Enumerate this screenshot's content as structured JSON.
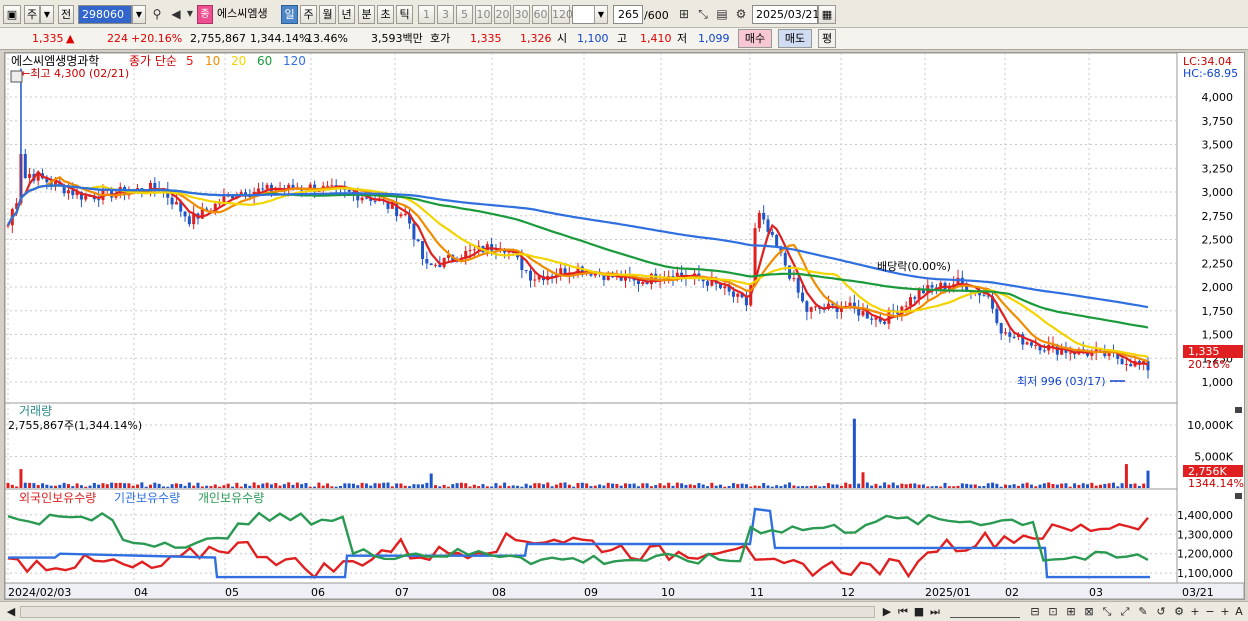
{
  "toolbar": {
    "market": "주",
    "period_prev": "전",
    "code": "298060",
    "badge": "종",
    "name": "에스씨엠생",
    "periods": [
      "일",
      "주",
      "월",
      "년",
      "분",
      "초",
      "틱"
    ],
    "ticks": [
      "1",
      "3",
      "5",
      "10",
      "20",
      "30",
      "60",
      "120"
    ],
    "count": "265",
    "count_max": "/600",
    "date": "2025/03/21"
  },
  "quote": {
    "price": "1,335",
    "arrow": "▲",
    "change": "224",
    "change_pct": "+20.16%",
    "volume": "2,755,867",
    "vol_pct": "1,344.14%",
    "turnover": "13.46%",
    "amount": "3,593백만",
    "hoga_label": "호가",
    "ask": "1,335",
    "bid": "1,326",
    "open_label": "시",
    "open": "1,100",
    "high_label": "고",
    "high": "1,410",
    "low_label": "저",
    "low": "1,099",
    "buy": "매수",
    "sell": "매도",
    "eval": "평"
  },
  "price_panel": {
    "title": "에스씨엠생명과학",
    "ma_label": "종가 단순",
    "ma": [
      {
        "label": "5",
        "color": "#e02020"
      },
      {
        "label": "10",
        "color": "#f08c00"
      },
      {
        "label": "20",
        "color": "#f4d400"
      },
      {
        "label": "60",
        "color": "#1a9a3a"
      },
      {
        "label": "120",
        "color": "#2f6fe0"
      }
    ],
    "lc": "LC:34.04",
    "hc": "HC:-68.95",
    "high_note": "←최고 4,300 (02/21)",
    "low_note": "최저 996 (03/17)",
    "div_note": "배당락(0.00%)",
    "yticks": [
      "4,000",
      "3,750",
      "3,500",
      "3,250",
      "3,000",
      "2,750",
      "2,500",
      "2,250",
      "2,000",
      "1,750",
      "1,500",
      "1,250",
      "1,000"
    ],
    "cur_price": "1,335",
    "cur_pct": "20.16%"
  },
  "volume_panel": {
    "title": "거래량",
    "value": "2,755,867주(1,344.14%)",
    "yticks": [
      "10,000K",
      "5,000K"
    ],
    "cur": "2,756K",
    "cur_pct": "1344.14%"
  },
  "holding_panel": {
    "legend": [
      {
        "label": "외국인보유수량",
        "color": "#e02020"
      },
      {
        "label": "기관보유수량",
        "color": "#2f6fe0"
      },
      {
        "label": "개인보유수량",
        "color": "#2a9a52"
      }
    ],
    "yticks": [
      "1,400,000",
      "1,300,000",
      "1,200,000",
      "1,100,000"
    ]
  },
  "xaxis": [
    "2024/02/03",
    "04",
    "05",
    "06",
    "07",
    "08",
    "09",
    "10",
    "11",
    "12",
    "2025/01",
    "02",
    "03",
    "03/21"
  ],
  "colors": {
    "up": "#e02020",
    "down": "#1f55c8",
    "grid": "#c8c8c8"
  }
}
